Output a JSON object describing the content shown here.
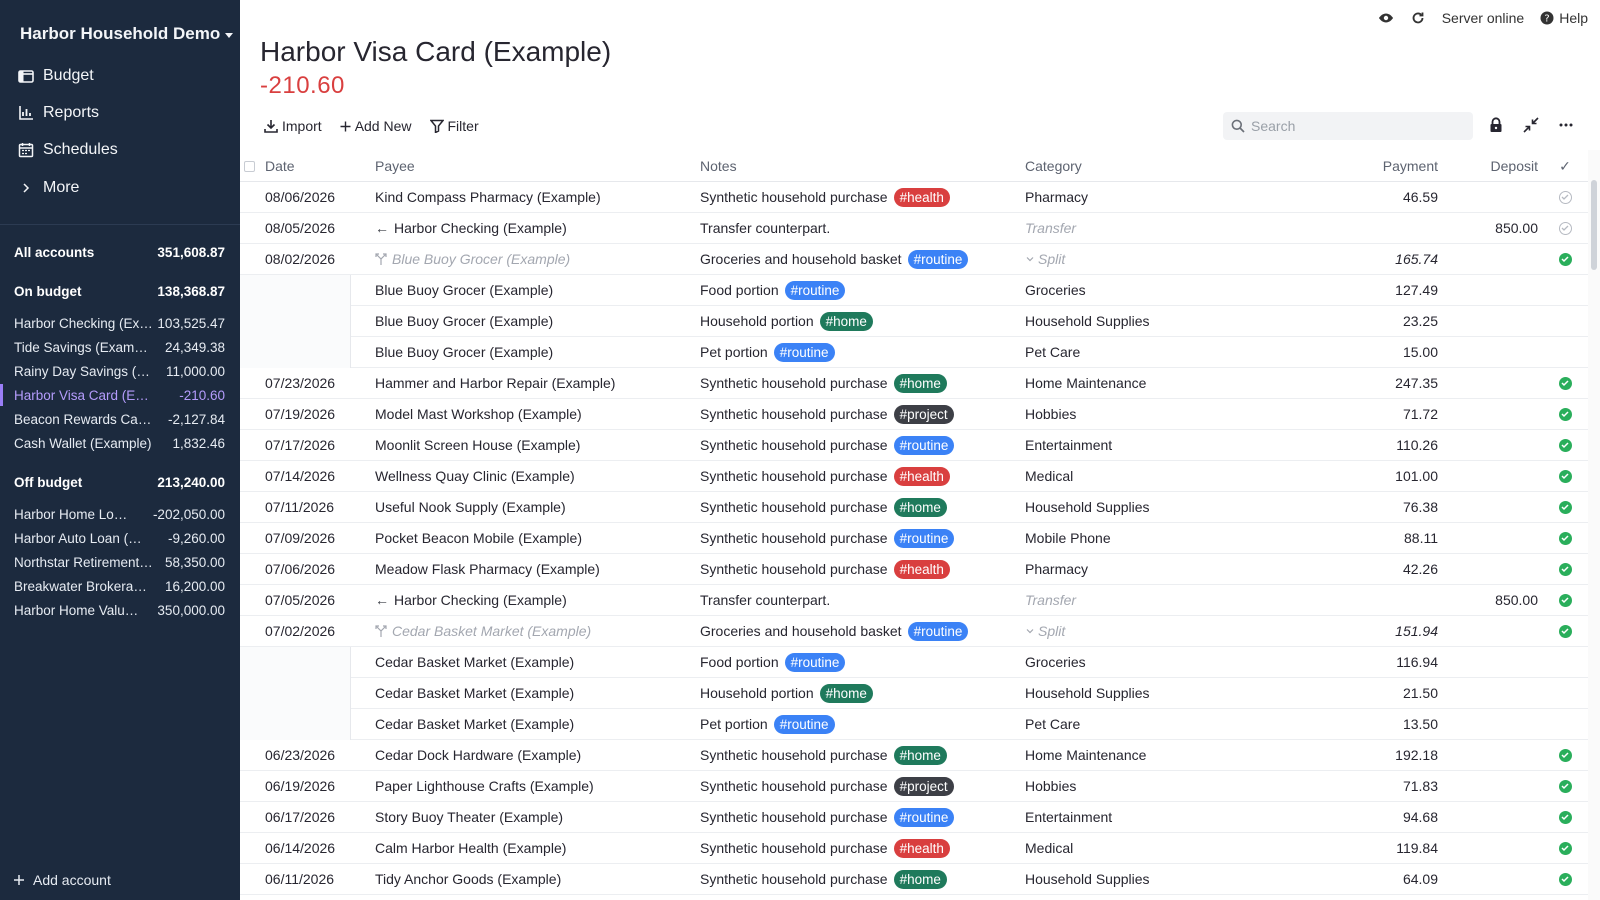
{
  "app": {
    "budget_name": "Harbor Household Demo",
    "status": "Server online",
    "help": "Help"
  },
  "nav": [
    {
      "label": "Budget",
      "icon": "wallet-icon"
    },
    {
      "label": "Reports",
      "icon": "chart-icon"
    },
    {
      "label": "Schedules",
      "icon": "calendar-icon"
    },
    {
      "label": "More",
      "icon": "chevron-right-icon"
    }
  ],
  "accounts": {
    "all": {
      "label": "All accounts",
      "value": "351,608.87"
    },
    "on_budget": {
      "label": "On budget",
      "value": "138,368.87"
    },
    "on_list": [
      {
        "name": "Harbor Checking (Example)",
        "value": "103,525.47"
      },
      {
        "name": "Tide Savings (Example)",
        "value": "24,349.38"
      },
      {
        "name": "Rainy Day Savings (Example)",
        "value": "11,000.00"
      },
      {
        "name": "Harbor Visa Card (Example)",
        "value": "-210.60"
      },
      {
        "name": "Beacon Rewards Card (Example)",
        "value": "-2,127.84"
      },
      {
        "name": "Cash Wallet (Example)",
        "value": "1,832.46"
      }
    ],
    "off_budget": {
      "label": "Off budget",
      "value": "213,240.00"
    },
    "off_list": [
      {
        "name": "Harbor Home Loan (Example)",
        "value": "-202,050.00"
      },
      {
        "name": "Harbor Auto Loan (Example)",
        "value": "-9,260.00"
      },
      {
        "name": "Northstar Retirement (Example)",
        "value": "58,350.00"
      },
      {
        "name": "Breakwater Brokerage (Example)",
        "value": "16,200.00"
      },
      {
        "name": "Harbor Home Value (Example)",
        "value": "350,000.00"
      }
    ],
    "add_label": "Add account"
  },
  "account_view": {
    "title": "Harbor Visa Card (Example)",
    "balance": "-210.60",
    "toolbar": {
      "import": "Import",
      "add_new": "Add New",
      "filter": "Filter"
    },
    "search_placeholder": "Search"
  },
  "columns": {
    "date": "Date",
    "payee": "Payee",
    "notes": "Notes",
    "category": "Category",
    "payment": "Payment",
    "deposit": "Deposit",
    "cleared": "✓"
  },
  "tag_colors": {
    "health": "#d93f3f",
    "routine": "#3b82f6",
    "home": "#1f7a5c",
    "project": "#3d3f46"
  },
  "transactions": [
    {
      "date": "08/06/2026",
      "payee": "Kind Compass Pharmacy (Example)",
      "notes": "Synthetic household purchase",
      "tag": "#health",
      "tagType": "health",
      "category": "Pharmacy",
      "payment": "46.59",
      "deposit": "",
      "check": "empty",
      "kind": "normal"
    },
    {
      "date": "08/05/2026",
      "payee": "Harbor Checking (Example)",
      "notes": "Transfer counterpart.",
      "tag": "",
      "tagType": "",
      "category": "Transfer",
      "payment": "",
      "deposit": "850.00",
      "check": "empty",
      "kind": "transfer"
    },
    {
      "date": "08/02/2026",
      "payee": "Blue Buoy Grocer (Example)",
      "notes": "Groceries and household basket",
      "tag": "#routine",
      "tagType": "routine",
      "category": "Split",
      "payment": "165.74",
      "deposit": "",
      "check": "ok",
      "kind": "split"
    },
    {
      "date": "",
      "payee": "Blue Buoy Grocer (Example)",
      "notes": "Food portion",
      "tag": "#routine",
      "tagType": "routine",
      "category": "Groceries",
      "payment": "127.49",
      "deposit": "",
      "check": "",
      "kind": "sub"
    },
    {
      "date": "",
      "payee": "Blue Buoy Grocer (Example)",
      "notes": "Household portion",
      "tag": "#home",
      "tagType": "home",
      "category": "Household Supplies",
      "payment": "23.25",
      "deposit": "",
      "check": "",
      "kind": "sub"
    },
    {
      "date": "",
      "payee": "Blue Buoy Grocer (Example)",
      "notes": "Pet portion",
      "tag": "#routine",
      "tagType": "routine",
      "category": "Pet Care",
      "payment": "15.00",
      "deposit": "",
      "check": "",
      "kind": "sub"
    },
    {
      "date": "07/23/2026",
      "payee": "Hammer and Harbor Repair (Example)",
      "notes": "Synthetic household purchase",
      "tag": "#home",
      "tagType": "home",
      "category": "Home Maintenance",
      "payment": "247.35",
      "deposit": "",
      "check": "ok",
      "kind": "normal"
    },
    {
      "date": "07/19/2026",
      "payee": "Model Mast Workshop (Example)",
      "notes": "Synthetic household purchase",
      "tag": "#project",
      "tagType": "project",
      "category": "Hobbies",
      "payment": "71.72",
      "deposit": "",
      "check": "ok",
      "kind": "normal"
    },
    {
      "date": "07/17/2026",
      "payee": "Moonlit Screen House (Example)",
      "notes": "Synthetic household purchase",
      "tag": "#routine",
      "tagType": "routine",
      "category": "Entertainment",
      "payment": "110.26",
      "deposit": "",
      "check": "ok",
      "kind": "normal"
    },
    {
      "date": "07/14/2026",
      "payee": "Wellness Quay Clinic (Example)",
      "notes": "Synthetic household purchase",
      "tag": "#health",
      "tagType": "health",
      "category": "Medical",
      "payment": "101.00",
      "deposit": "",
      "check": "ok",
      "kind": "normal"
    },
    {
      "date": "07/11/2026",
      "payee": "Useful Nook Supply (Example)",
      "notes": "Synthetic household purchase",
      "tag": "#home",
      "tagType": "home",
      "category": "Household Supplies",
      "payment": "76.38",
      "deposit": "",
      "check": "ok",
      "kind": "normal"
    },
    {
      "date": "07/09/2026",
      "payee": "Pocket Beacon Mobile (Example)",
      "notes": "Synthetic household purchase",
      "tag": "#routine",
      "tagType": "routine",
      "category": "Mobile Phone",
      "payment": "88.11",
      "deposit": "",
      "check": "ok",
      "kind": "normal"
    },
    {
      "date": "07/06/2026",
      "payee": "Meadow Flask Pharmacy (Example)",
      "notes": "Synthetic household purchase",
      "tag": "#health",
      "tagType": "health",
      "category": "Pharmacy",
      "payment": "42.26",
      "deposit": "",
      "check": "ok",
      "kind": "normal"
    },
    {
      "date": "07/05/2026",
      "payee": "Harbor Checking (Example)",
      "notes": "Transfer counterpart.",
      "tag": "",
      "tagType": "",
      "category": "Transfer",
      "payment": "",
      "deposit": "850.00",
      "check": "ok",
      "kind": "transfer"
    },
    {
      "date": "07/02/2026",
      "payee": "Cedar Basket Market (Example)",
      "notes": "Groceries and household basket",
      "tag": "#routine",
      "tagType": "routine",
      "category": "Split",
      "payment": "151.94",
      "deposit": "",
      "check": "ok",
      "kind": "split"
    },
    {
      "date": "",
      "payee": "Cedar Basket Market (Example)",
      "notes": "Food portion",
      "tag": "#routine",
      "tagType": "routine",
      "category": "Groceries",
      "payment": "116.94",
      "deposit": "",
      "check": "",
      "kind": "sub"
    },
    {
      "date": "",
      "payee": "Cedar Basket Market (Example)",
      "notes": "Household portion",
      "tag": "#home",
      "tagType": "home",
      "category": "Household Supplies",
      "payment": "21.50",
      "deposit": "",
      "check": "",
      "kind": "sub"
    },
    {
      "date": "",
      "payee": "Cedar Basket Market (Example)",
      "notes": "Pet portion",
      "tag": "#routine",
      "tagType": "routine",
      "category": "Pet Care",
      "payment": "13.50",
      "deposit": "",
      "check": "",
      "kind": "sub"
    },
    {
      "date": "06/23/2026",
      "payee": "Cedar Dock Hardware (Example)",
      "notes": "Synthetic household purchase",
      "tag": "#home",
      "tagType": "home",
      "category": "Home Maintenance",
      "payment": "192.18",
      "deposit": "",
      "check": "ok",
      "kind": "normal"
    },
    {
      "date": "06/19/2026",
      "payee": "Paper Lighthouse Crafts (Example)",
      "notes": "Synthetic household purchase",
      "tag": "#project",
      "tagType": "project",
      "category": "Hobbies",
      "payment": "71.83",
      "deposit": "",
      "check": "ok",
      "kind": "normal"
    },
    {
      "date": "06/17/2026",
      "payee": "Story Buoy Theater (Example)",
      "notes": "Synthetic household purchase",
      "tag": "#routine",
      "tagType": "routine",
      "category": "Entertainment",
      "payment": "94.68",
      "deposit": "",
      "check": "ok",
      "kind": "normal"
    },
    {
      "date": "06/14/2026",
      "payee": "Calm Harbor Health (Example)",
      "notes": "Synthetic household purchase",
      "tag": "#health",
      "tagType": "health",
      "category": "Medical",
      "payment": "119.84",
      "deposit": "",
      "check": "ok",
      "kind": "normal"
    },
    {
      "date": "06/11/2026",
      "payee": "Tidy Anchor Goods (Example)",
      "notes": "Synthetic household purchase",
      "tag": "#home",
      "tagType": "home",
      "category": "Household Supplies",
      "payment": "64.09",
      "deposit": "",
      "check": "ok",
      "kind": "normal"
    }
  ]
}
